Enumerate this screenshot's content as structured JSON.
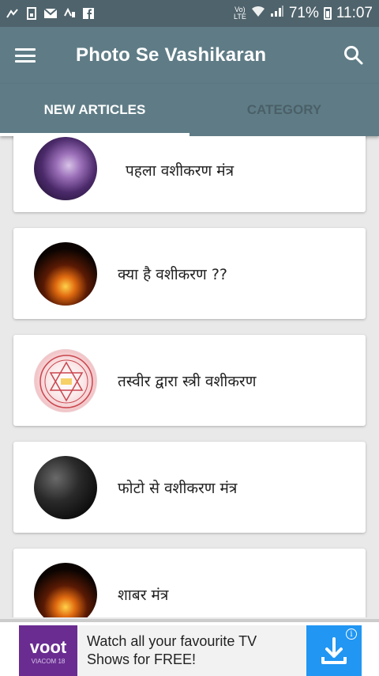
{
  "status_bar": {
    "notification_icons": [
      "missed-call-icon",
      "file-icon",
      "email-icon",
      "fa-icon",
      "facebook-icon"
    ],
    "network_label_top": "Vo)",
    "network_label_bottom": "LTE",
    "battery_percent": "71%",
    "time": "11:07"
  },
  "app_bar": {
    "title": "Photo Se Vashikaran",
    "menu_icon": "hamburger-menu-icon",
    "search_icon": "search-icon"
  },
  "tabs": [
    {
      "label": "NEW ARTICLES",
      "active": true
    },
    {
      "label": "CATEGORY",
      "active": false
    }
  ],
  "articles": [
    {
      "title": "पहला वशीकरण मंत्र"
    },
    {
      "title": "क्या है वशीकरण ??"
    },
    {
      "title": "तस्वीर द्वारा स्त्री वशीकरण"
    },
    {
      "title": "फोटो से वशीकरण मंत्र"
    },
    {
      "title": "शाबर मंत्र"
    }
  ],
  "ad": {
    "logo_text": "voot",
    "logo_sub": "VIACOM 18",
    "text_line1": "Watch all your favourite TV",
    "text_line2": "Shows for FREE!",
    "info_label": "i"
  },
  "colors": {
    "status_bar": "#4f636c",
    "app_bar": "#5f7c86",
    "background": "#e9e9e9",
    "ad_button": "#2196f3",
    "voot_brand": "#6a2c91"
  }
}
